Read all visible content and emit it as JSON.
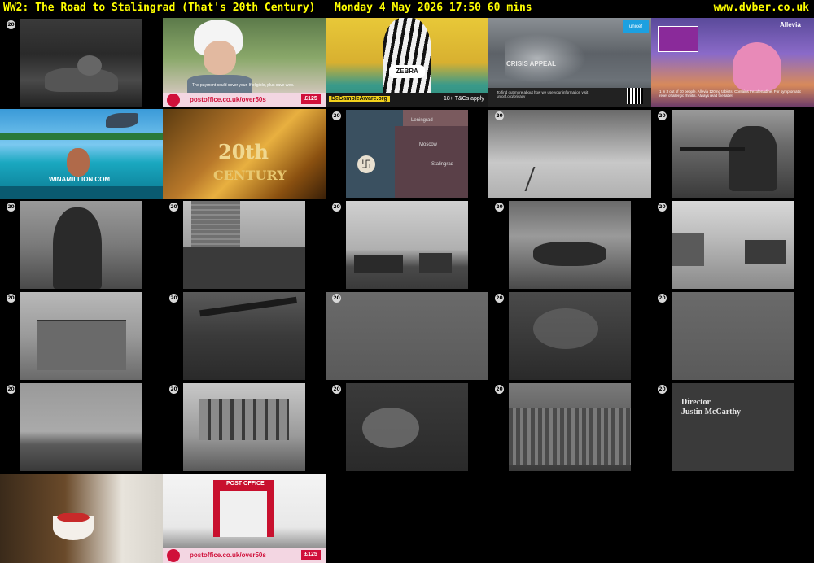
{
  "header": {
    "programme": "WW2: The Road to Stalingrad (That's 20th Century)",
    "datetime": "Monday 4 May 2026  17:50  60 mins",
    "site": "www.dvber.co.uk"
  },
  "channel_logo": "20",
  "thumbnails": [
    {
      "kind": "bw",
      "desc": "soldiers-trench"
    },
    {
      "kind": "ad",
      "desc": "postoffice-woman"
    },
    {
      "kind": "ad",
      "desc": "zebra-gamble"
    },
    {
      "kind": "ad",
      "desc": "unicef-appeal"
    },
    {
      "kind": "ad",
      "desc": "allevia-monster"
    },
    {
      "kind": "ad",
      "desc": "winamillion-beach"
    },
    {
      "kind": "title",
      "desc": "20th-century-title"
    },
    {
      "kind": "map",
      "desc": "europe-map"
    },
    {
      "kind": "bw",
      "desc": "snow-field"
    },
    {
      "kind": "bw",
      "desc": "machine-gunner"
    },
    {
      "kind": "bw",
      "desc": "soldier-closeup"
    },
    {
      "kind": "bw",
      "desc": "tower-ruins"
    },
    {
      "kind": "bw",
      "desc": "tanks-field"
    },
    {
      "kind": "bw",
      "desc": "soldiers-running"
    },
    {
      "kind": "bw",
      "desc": "tank-village"
    },
    {
      "kind": "bw",
      "desc": "bombed-building"
    },
    {
      "kind": "bw",
      "desc": "dark-gun"
    },
    {
      "kind": "bw",
      "desc": "grey-blur"
    },
    {
      "kind": "bw",
      "desc": "smoke-dark"
    },
    {
      "kind": "bw",
      "desc": "fog"
    },
    {
      "kind": "bw",
      "desc": "city-skyline"
    },
    {
      "kind": "bw",
      "desc": "street-building"
    },
    {
      "kind": "bw",
      "desc": "explosion"
    },
    {
      "kind": "bw",
      "desc": "troops-marching"
    },
    {
      "kind": "credit",
      "desc": "director-credit"
    },
    {
      "kind": "ad",
      "desc": "strawberry-bowl"
    },
    {
      "kind": "ad",
      "desc": "postoffice-shop"
    }
  ],
  "ads": {
    "postoffice_url": "postoffice.co.uk/over50s",
    "postoffice_price": "£125",
    "postoffice_fine": "The payment could cover your. If eligible, plus save web.",
    "gamble_badge": "BeGambleAware.org",
    "gamble_terms": "18+ T&Cs apply",
    "zebra_label": "ZEBRA",
    "unicef_brand": "unicef",
    "unicef_heading": "CRISIS APPEAL",
    "unicef_fine": "To find out more about how we use your information visit unicef.org/privacy",
    "allevia_brand": "Allevia",
    "allevia_fine": "1 in 3 out of 10 people. Allevia 120mg tablets. Contains Fexofenadine. For symptomatic relief of allergic rhinitis. Always read the label.",
    "win_brand": "WINAMILLION.COM",
    "shop_sign": "POST OFFICE"
  },
  "title_card": {
    "line1": "20th",
    "line2": "CENTURY"
  },
  "map_labels": [
    "Leningrad",
    "Moscow",
    "Stalingrad"
  ],
  "credit": {
    "role": "Director",
    "name": "Justin McCarthy"
  }
}
